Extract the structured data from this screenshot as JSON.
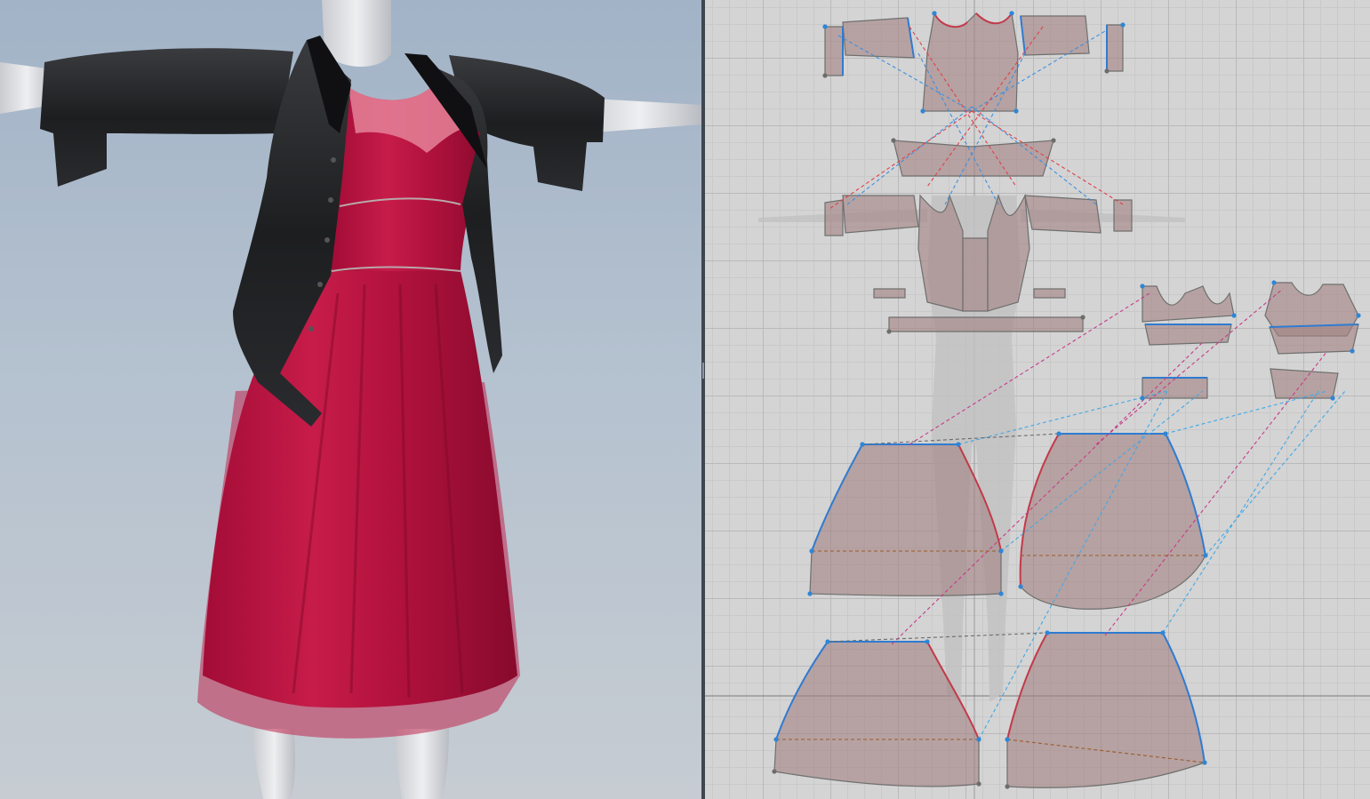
{
  "app": {
    "views": [
      "3d-garment-view",
      "2d-pattern-view"
    ]
  },
  "colors": {
    "sky_top": "#a2b3c7",
    "dress": "#b0103a",
    "jacket": "#1c1c1e",
    "avatar": "#dcdde0",
    "pattern_piece": "#a38383",
    "grid": "#d4d4d4",
    "seam_blue": "#2f7bd1",
    "seam_red": "#c23a4a"
  },
  "garment": {
    "pieces": [
      {
        "id": "jacket-left-sleeve-cuff"
      },
      {
        "id": "jacket-back"
      },
      {
        "id": "jacket-right-sleeve"
      },
      {
        "id": "jacket-collar"
      },
      {
        "id": "jacket-front-left"
      },
      {
        "id": "jacket-front-right"
      },
      {
        "id": "jacket-placket"
      },
      {
        "id": "jacket-waistband"
      },
      {
        "id": "bodice-front"
      },
      {
        "id": "bodice-back"
      },
      {
        "id": "bodice-waist-front"
      },
      {
        "id": "bodice-waist-back"
      },
      {
        "id": "skirt-front"
      },
      {
        "id": "skirt-back"
      },
      {
        "id": "underskirt-front"
      },
      {
        "id": "underskirt-back"
      }
    ]
  }
}
